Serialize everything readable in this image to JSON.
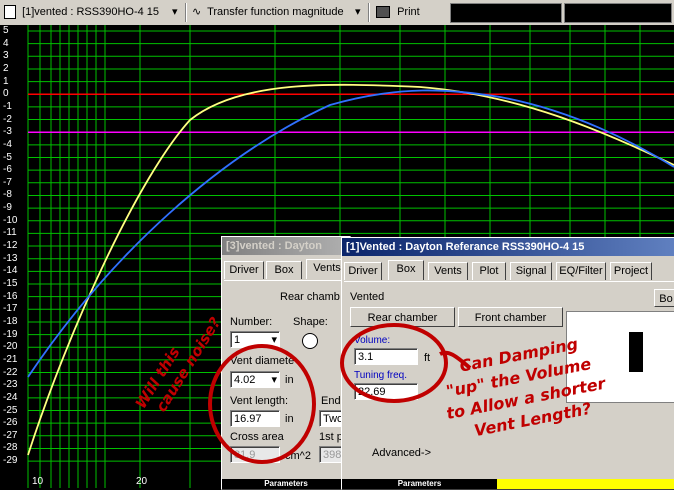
{
  "toolbar": {
    "project_label": "[1]vented : RSS390HO-4 15",
    "view_label": "Transfer function magnitude",
    "print_label": "Print"
  },
  "plot": {
    "y_ticks": [
      "5",
      "4",
      "3",
      "2",
      "1",
      "0",
      "-1",
      "-2",
      "-3",
      "-4",
      "-5",
      "-6",
      "-7",
      "-8",
      "-9",
      "-10",
      "-11",
      "-12",
      "-13",
      "-14",
      "-15",
      "-16",
      "-17",
      "-18",
      "-19",
      "-20",
      "-21",
      "-22",
      "-23",
      "-24",
      "-25",
      "-26",
      "-27",
      "-28",
      "-29"
    ],
    "x_ticks": [
      "10",
      "20"
    ],
    "colors": {
      "grid": "#00c000",
      "zero_line": "#ff0000",
      "ref_line": "#ff00ff",
      "yellow_curve": "#ffff80",
      "blue_curve": "#3070ff"
    }
  },
  "window3": {
    "title": "[3]vented : Dayton",
    "tabs": [
      "Driver",
      "Box",
      "Vents"
    ],
    "rear_chamber_button": "Rear chamb",
    "number_label": "Number:",
    "number_value": "1",
    "shape_label": "Shape:",
    "vent_diameter_label": "Vent diamete",
    "vent_diameter_value": "4.02",
    "vent_diameter_unit": "in",
    "vent_length_label": "Vent length:",
    "vent_length_value": "16.97",
    "vent_length_unit": "in",
    "end_label": "End",
    "end_value": "Two",
    "cross_area_label": "Cross area",
    "cross_area_value": "81.9",
    "cross_area_unit": "cm^2",
    "first_port_label": "1st po",
    "first_port_value": "398.",
    "footer": "Parameters"
  },
  "window1": {
    "title": "[1]Vented : Dayton Referance RSS390HO-4 15",
    "tabs": [
      "Driver",
      "Box",
      "Vents",
      "Plot",
      "Signal",
      "EQ/Filter",
      "Project"
    ],
    "section_label": "Vented",
    "rear_chamber_button": "Rear chamber",
    "front_chamber_button": "Front chamber",
    "volume_label": "Volume:",
    "volume_value": "3.1",
    "volume_unit": "ft",
    "tuning_label": "Tuning freq.",
    "tuning_value": "22.69",
    "advanced_label": "Advanced->",
    "footer": "Parameters",
    "side_button": "Bo"
  },
  "annotations": {
    "note_left_line1": "Will this",
    "note_left_line2": "cause noise?",
    "note_right_line1": "Can Damping",
    "note_right_line2": "\"up\" the Volume",
    "note_right_line3": "to Allow a shorter",
    "note_right_line4": "Vent Length?"
  }
}
